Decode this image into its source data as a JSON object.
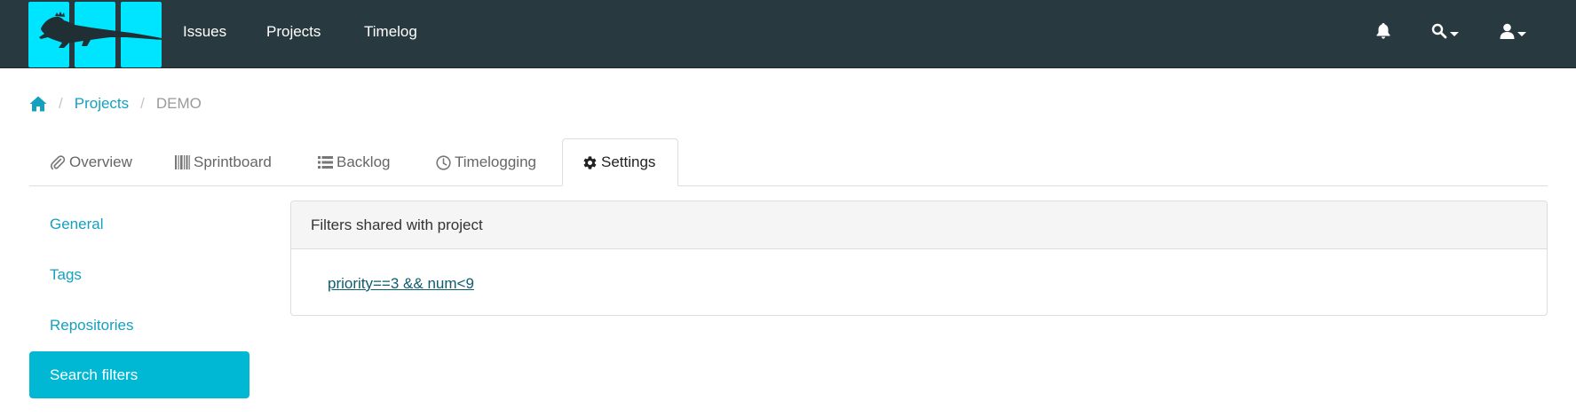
{
  "navbar": {
    "links": [
      {
        "label": "Issues"
      },
      {
        "label": "Projects"
      },
      {
        "label": "Timelog"
      }
    ],
    "icons": {
      "notifications": "bell-icon",
      "search": "search-icon",
      "user": "user-icon"
    }
  },
  "breadcrumb": {
    "home_icon": "home-icon",
    "items": [
      {
        "label": "Projects"
      },
      {
        "label": "DEMO"
      }
    ]
  },
  "tabs": [
    {
      "label": "Overview",
      "icon": "paperclip-icon"
    },
    {
      "label": "Sprintboard",
      "icon": "barcode-icon"
    },
    {
      "label": "Backlog",
      "icon": "list-icon"
    },
    {
      "label": "Timelogging",
      "icon": "clock-icon"
    },
    {
      "label": "Settings",
      "icon": "gear-icon",
      "active": true
    }
  ],
  "sidenav": {
    "items": [
      {
        "label": "General"
      },
      {
        "label": "Tags"
      },
      {
        "label": "Repositories"
      },
      {
        "label": "Search filters",
        "active": true
      }
    ]
  },
  "panel": {
    "heading": "Filters shared with project",
    "filters": [
      {
        "label": "priority==3 && num<9"
      }
    ]
  },
  "colors": {
    "navbar_bg": "#283a40",
    "accent": "#00b7d4",
    "link": "#15a0c0",
    "logo": "#00e5ff"
  }
}
